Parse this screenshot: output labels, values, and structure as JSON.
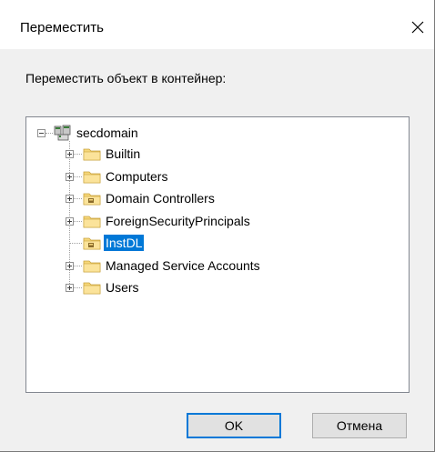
{
  "dialog": {
    "title": "Переместить",
    "close_icon": "close-icon",
    "prompt": "Переместить объект в контейнер:"
  },
  "tree": {
    "root": {
      "label": "secdomain",
      "icon": "domain-icon",
      "expanded": true
    },
    "children": [
      {
        "label": "Builtin",
        "icon": "folder-icon",
        "expandable": true,
        "selected": false
      },
      {
        "label": "Computers",
        "icon": "folder-icon",
        "expandable": true,
        "selected": false
      },
      {
        "label": "Domain Controllers",
        "icon": "ou-folder-icon",
        "expandable": true,
        "selected": false
      },
      {
        "label": "ForeignSecurityPrincipals",
        "icon": "folder-icon",
        "expandable": true,
        "selected": false
      },
      {
        "label": "InstDL",
        "icon": "ou-folder-icon",
        "expandable": false,
        "selected": true
      },
      {
        "label": "Managed Service Accounts",
        "icon": "folder-icon",
        "expandable": true,
        "selected": false
      },
      {
        "label": "Users",
        "icon": "folder-icon",
        "expandable": true,
        "selected": false
      }
    ]
  },
  "buttons": {
    "ok": "OK",
    "cancel": "Отмена"
  },
  "colors": {
    "selection": "#0078d7",
    "folder": "#f6d77a",
    "background": "#f0f0f0"
  }
}
